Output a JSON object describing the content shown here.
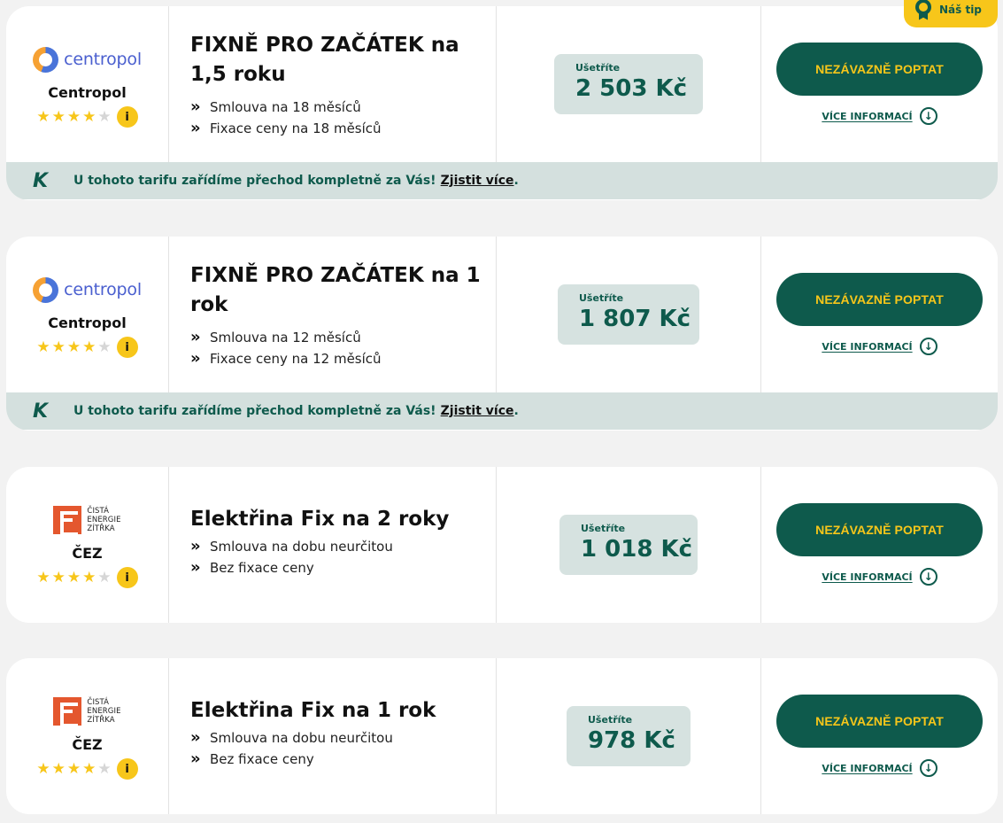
{
  "badge": {
    "label": "Náš tip"
  },
  "cards": [
    {
      "brand": "Centropol",
      "logo_type": "centropol",
      "logo_text": "centropol",
      "rating": 4,
      "rating_max": 5,
      "info_label": "i",
      "title": "FIXNĚ PRO ZAČÁTEK na 1,5 roku",
      "features": [
        "Smlouva na 18 měsíců",
        "Fixace ceny na 18 měsíců"
      ],
      "save_label": "Ušetříte",
      "save_amount": "2 503 Kč",
      "cta_label": "NEZÁVAZNĚ POPTAT",
      "more_label": "VÍCE INFORMACÍ",
      "banner": {
        "text": "U tohoto tarifu zařídíme přechod kompletně za Vás!",
        "link": "Zjistit více",
        "end": "."
      }
    },
    {
      "brand": "Centropol",
      "logo_type": "centropol",
      "logo_text": "centropol",
      "rating": 4,
      "rating_max": 5,
      "info_label": "i",
      "title": "FIXNĚ PRO ZAČÁTEK na 1 rok",
      "features": [
        "Smlouva na 12 měsíců",
        "Fixace ceny na 12 měsíců"
      ],
      "save_label": "Ušetříte",
      "save_amount": "1 807 Kč",
      "cta_label": "NEZÁVAZNĚ POPTAT",
      "more_label": "VÍCE INFORMACÍ",
      "banner": {
        "text": "U tohoto tarifu zařídíme přechod kompletně za Vás!",
        "link": "Zjistit více",
        "end": "."
      }
    },
    {
      "brand": "ČEZ",
      "logo_type": "cez",
      "logo_text": "ČISTÁ ENERGIE ZÍTŘKA",
      "logo_lines": [
        "ČISTÁ",
        "ENERGIE",
        "ZÍTŘKA"
      ],
      "rating": 4,
      "rating_max": 5,
      "info_label": "i",
      "title": "Elektřina Fix na 2 roky",
      "features": [
        "Smlouva na dobu neurčitou",
        "Bez fixace ceny"
      ],
      "save_label": "Ušetříte",
      "save_amount": "1 018 Kč",
      "cta_label": "NEZÁVAZNĚ POPTAT",
      "more_label": "VÍCE INFORMACÍ"
    },
    {
      "brand": "ČEZ",
      "logo_type": "cez",
      "logo_text": "ČISTÁ ENERGIE ZÍTŘKA",
      "logo_lines": [
        "ČISTÁ",
        "ENERGIE",
        "ZÍTŘKA"
      ],
      "rating": 4,
      "rating_max": 5,
      "info_label": "i",
      "title": "Elektřina Fix na 1 rok",
      "features": [
        "Smlouva na dobu neurčitou",
        "Bez fixace ceny"
      ],
      "save_label": "Ušetříte",
      "save_amount": "978 Kč",
      "cta_label": "NEZÁVAZNĚ POPTAT",
      "more_label": "VÍCE INFORMACÍ"
    }
  ]
}
